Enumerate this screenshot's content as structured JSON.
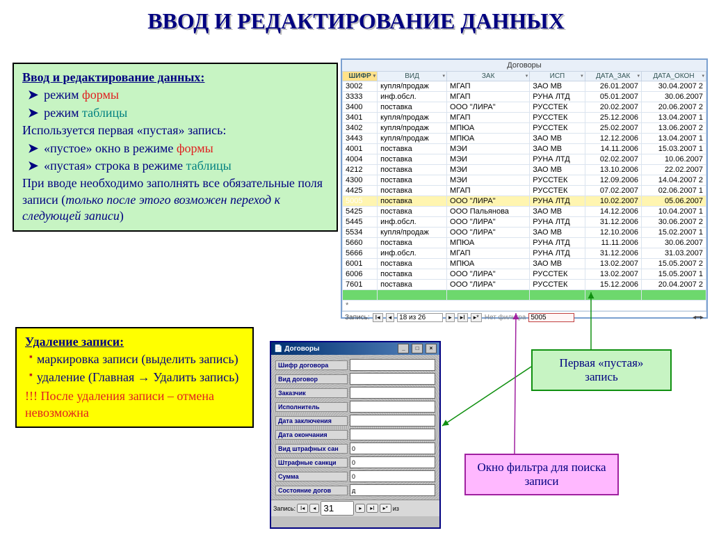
{
  "title": "ВВОД И РЕДАКТИРОВАНИЕ ДАННЫХ",
  "greenbox": {
    "header": "Ввод и редактирование данных:",
    "b1_pre": "режим ",
    "b1_em": "формы",
    "b2_pre": "режим ",
    "b2_em": "таблицы",
    "p1": "Используется первая «пустая» запись:",
    "b3_pre": "«пустое» окно в режиме ",
    "b3_em": "формы",
    "b4_pre": "«пустая» строка в режиме ",
    "b4_em": "таблицы",
    "p2_a": "При вводе необходимо заполнять все обязательные поля записи (",
    "p2_i": "только после этого возможен переход к следующей записи",
    "p2_b": ")"
  },
  "yellowbox": {
    "header": "Удаление записи:",
    "b1": "маркировка записи (выделить запись)",
    "b2": "удаление (Главная → Удалить запись)",
    "warn": "!!! После удаления записи – отмена невозможна"
  },
  "callouts": {
    "empty_record": "Первая «пустая» запись",
    "filter_window": "Окно фильтра для поиска записи"
  },
  "sheet": {
    "title": "Договоры",
    "columns": [
      "ШИФР",
      "ВИД",
      "ЗАК",
      "ИСП",
      "ДАТА_ЗАК",
      "ДАТА_ОКОН"
    ],
    "rows": [
      [
        "3002",
        "купля/продаж",
        "МГАП",
        "ЗАО МВ",
        "26.01.2007",
        "30.04.2007 2"
      ],
      [
        "3333",
        "инф.обсл.",
        "МГАП",
        "РУНА ЛТД",
        "05.01.2007",
        "30.06.2007"
      ],
      [
        "3400",
        "поставка",
        "ООО \"ЛИРА\"",
        "РУССТЕК",
        "20.02.2007",
        "20.06.2007 2"
      ],
      [
        "3401",
        "купля/продаж",
        "МГАП",
        "РУССТЕК",
        "25.12.2006",
        "13.04.2007 1"
      ],
      [
        "3402",
        "купля/продаж",
        "МПЮА",
        "РУССТЕК",
        "25.02.2007",
        "13.06.2007 2"
      ],
      [
        "3443",
        "купля/продаж",
        "МПЮА",
        "ЗАО МВ",
        "12.12.2006",
        "13.04.2007 1"
      ],
      [
        "4001",
        "поставка",
        "МЭИ",
        "ЗАО МВ",
        "14.11.2006",
        "15.03.2007 1"
      ],
      [
        "4004",
        "поставка",
        "МЭИ",
        "РУНА ЛТД",
        "02.02.2007",
        "10.06.2007"
      ],
      [
        "4212",
        "поставка",
        "МЭИ",
        "ЗАО МВ",
        "13.10.2006",
        "22.02.2007"
      ],
      [
        "4300",
        "поставка",
        "МЭИ",
        "РУССТЕК",
        "12.09.2006",
        "14.04.2007 2"
      ],
      [
        "4425",
        "поставка",
        "МГАП",
        "РУССТЕК",
        "07.02.2007",
        "02.06.2007 1"
      ],
      [
        "5005",
        "поставка",
        "ООО \"ЛИРА\"",
        "РУНА ЛТД",
        "10.02.2007",
        "05.06.2007"
      ],
      [
        "5425",
        "поставка",
        "ООО Пальянова",
        "ЗАО МВ",
        "14.12.2006",
        "10.04.2007 1"
      ],
      [
        "5445",
        "инф.обсл.",
        "ООО \"ЛИРА\"",
        "РУНА ЛТД",
        "31.12.2006",
        "30.06.2007 2"
      ],
      [
        "5534",
        "купля/продаж",
        "ООО \"ЛИРА\"",
        "ЗАО МВ",
        "12.10.2006",
        "15.02.2007 1"
      ],
      [
        "5660",
        "поставка",
        "МПЮА",
        "РУНА ЛТД",
        "11.11.2006",
        "30.06.2007"
      ],
      [
        "5666",
        "инф.обсл.",
        "МГАП",
        "РУНА ЛТД",
        "31.12.2006",
        "31.03.2007"
      ],
      [
        "6001",
        "поставка",
        "МПЮА",
        "ЗАО МВ",
        "13.02.2007",
        "15.05.2007 2"
      ],
      [
        "6006",
        "поставка",
        "ООО \"ЛИРА\"",
        "РУССТЕК",
        "13.02.2007",
        "15.05.2007 1"
      ],
      [
        "7601",
        "поставка",
        "ООО \"ЛИРА\"",
        "РУССТЕК",
        "15.12.2006",
        "20.04.2007 2"
      ]
    ],
    "selected_index": 11,
    "recnav_label": "Запись:",
    "recnav_pos": "18 из 26",
    "recnav_filter_label": "Нет фильтра",
    "recnav_search": "5005"
  },
  "form": {
    "title": "Договоры",
    "fields": [
      {
        "label": "Шифр договора",
        "value": ""
      },
      {
        "label": "Вид договор",
        "value": ""
      },
      {
        "label": "Заказчик",
        "value": ""
      },
      {
        "label": "Исполнитель",
        "value": ""
      },
      {
        "label": "Дата заключения",
        "value": ""
      },
      {
        "label": "Дата окончания",
        "value": ""
      },
      {
        "label": "Вид штрафных сан",
        "value": "0"
      },
      {
        "label": "Штрафные санкци",
        "value": "0"
      },
      {
        "label": "Сумма",
        "value": "0"
      },
      {
        "label": "Состояние догов",
        "value": "д"
      }
    ],
    "nav_label": "Запись:",
    "nav_pos": "31",
    "nav_of": "из"
  }
}
